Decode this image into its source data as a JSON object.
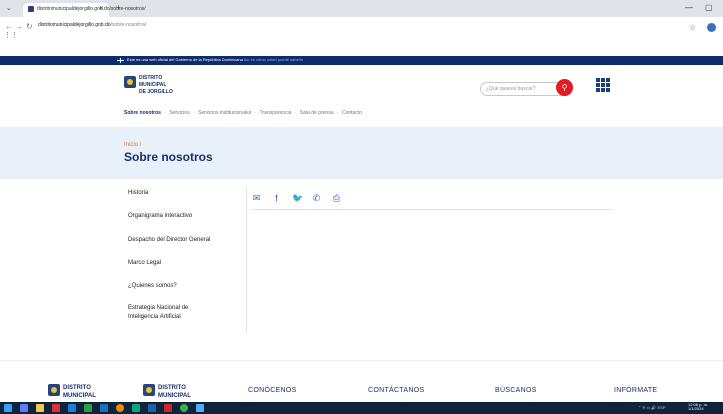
{
  "browser": {
    "tab_title": "distritomunicipaldejorgillo.gob.do/sobre-nosotros/",
    "tab_close": "✕",
    "new_tab": "+",
    "minimize": "—",
    "maximize": "▢",
    "url_host": "distritomunicipaldejorgillo.gob.do",
    "url_path": "/sobre-nosotros/"
  },
  "gov_bar": {
    "text": "Este es una web oficial del Gobierno de la República Dominicana",
    "link": "Así es cómo usted puede saberlo"
  },
  "logo": {
    "line1": "DISTRITO",
    "line2": "MUNICIPAL",
    "line3": "DE JORGILLO"
  },
  "search": {
    "placeholder": "¿Qué quieres buscar?"
  },
  "nav": {
    "items": [
      "Sobre nosotros",
      "Servicios",
      "Servicios institucionales",
      "Transparencia",
      "Sala de prensa",
      "Contacto"
    ]
  },
  "hero": {
    "breadcrumb": "Inicio /",
    "title": "Sobre nosotros"
  },
  "sidebar": {
    "items": [
      "Historia",
      "Organigrama interactivo",
      "Despacho del Director General",
      "Marco Legal",
      "¿Quienes somos?",
      "Estrategia Nacional de",
      "Inteligencia Artificial"
    ]
  },
  "share_icons": [
    "mail-icon",
    "facebook-icon",
    "twitter-icon",
    "whatsapp-icon",
    "print-icon"
  ],
  "footer": {
    "logo1_line1": "DISTRITO",
    "logo1_line2": "MUNICIPAL",
    "logo2_line1": "DISTRITO",
    "logo2_line2": "MUNICIPAL",
    "columns": [
      "CONÓCENOS",
      "CONTÁCTANOS",
      "BÚSCANOS",
      "INFÓRMATE"
    ]
  },
  "taskbar": {
    "time": "12:08 p. m.",
    "date": "1/1/2024",
    "lang": "ESP"
  },
  "colors": {
    "brand_navy": "#1a2f6b",
    "gov_bar": "#0d2c6b",
    "accent_orange": "#e8733b",
    "search_red": "#e31b23",
    "share_blue": "#2a63d6",
    "hero_bg": "#e8f1f9"
  }
}
